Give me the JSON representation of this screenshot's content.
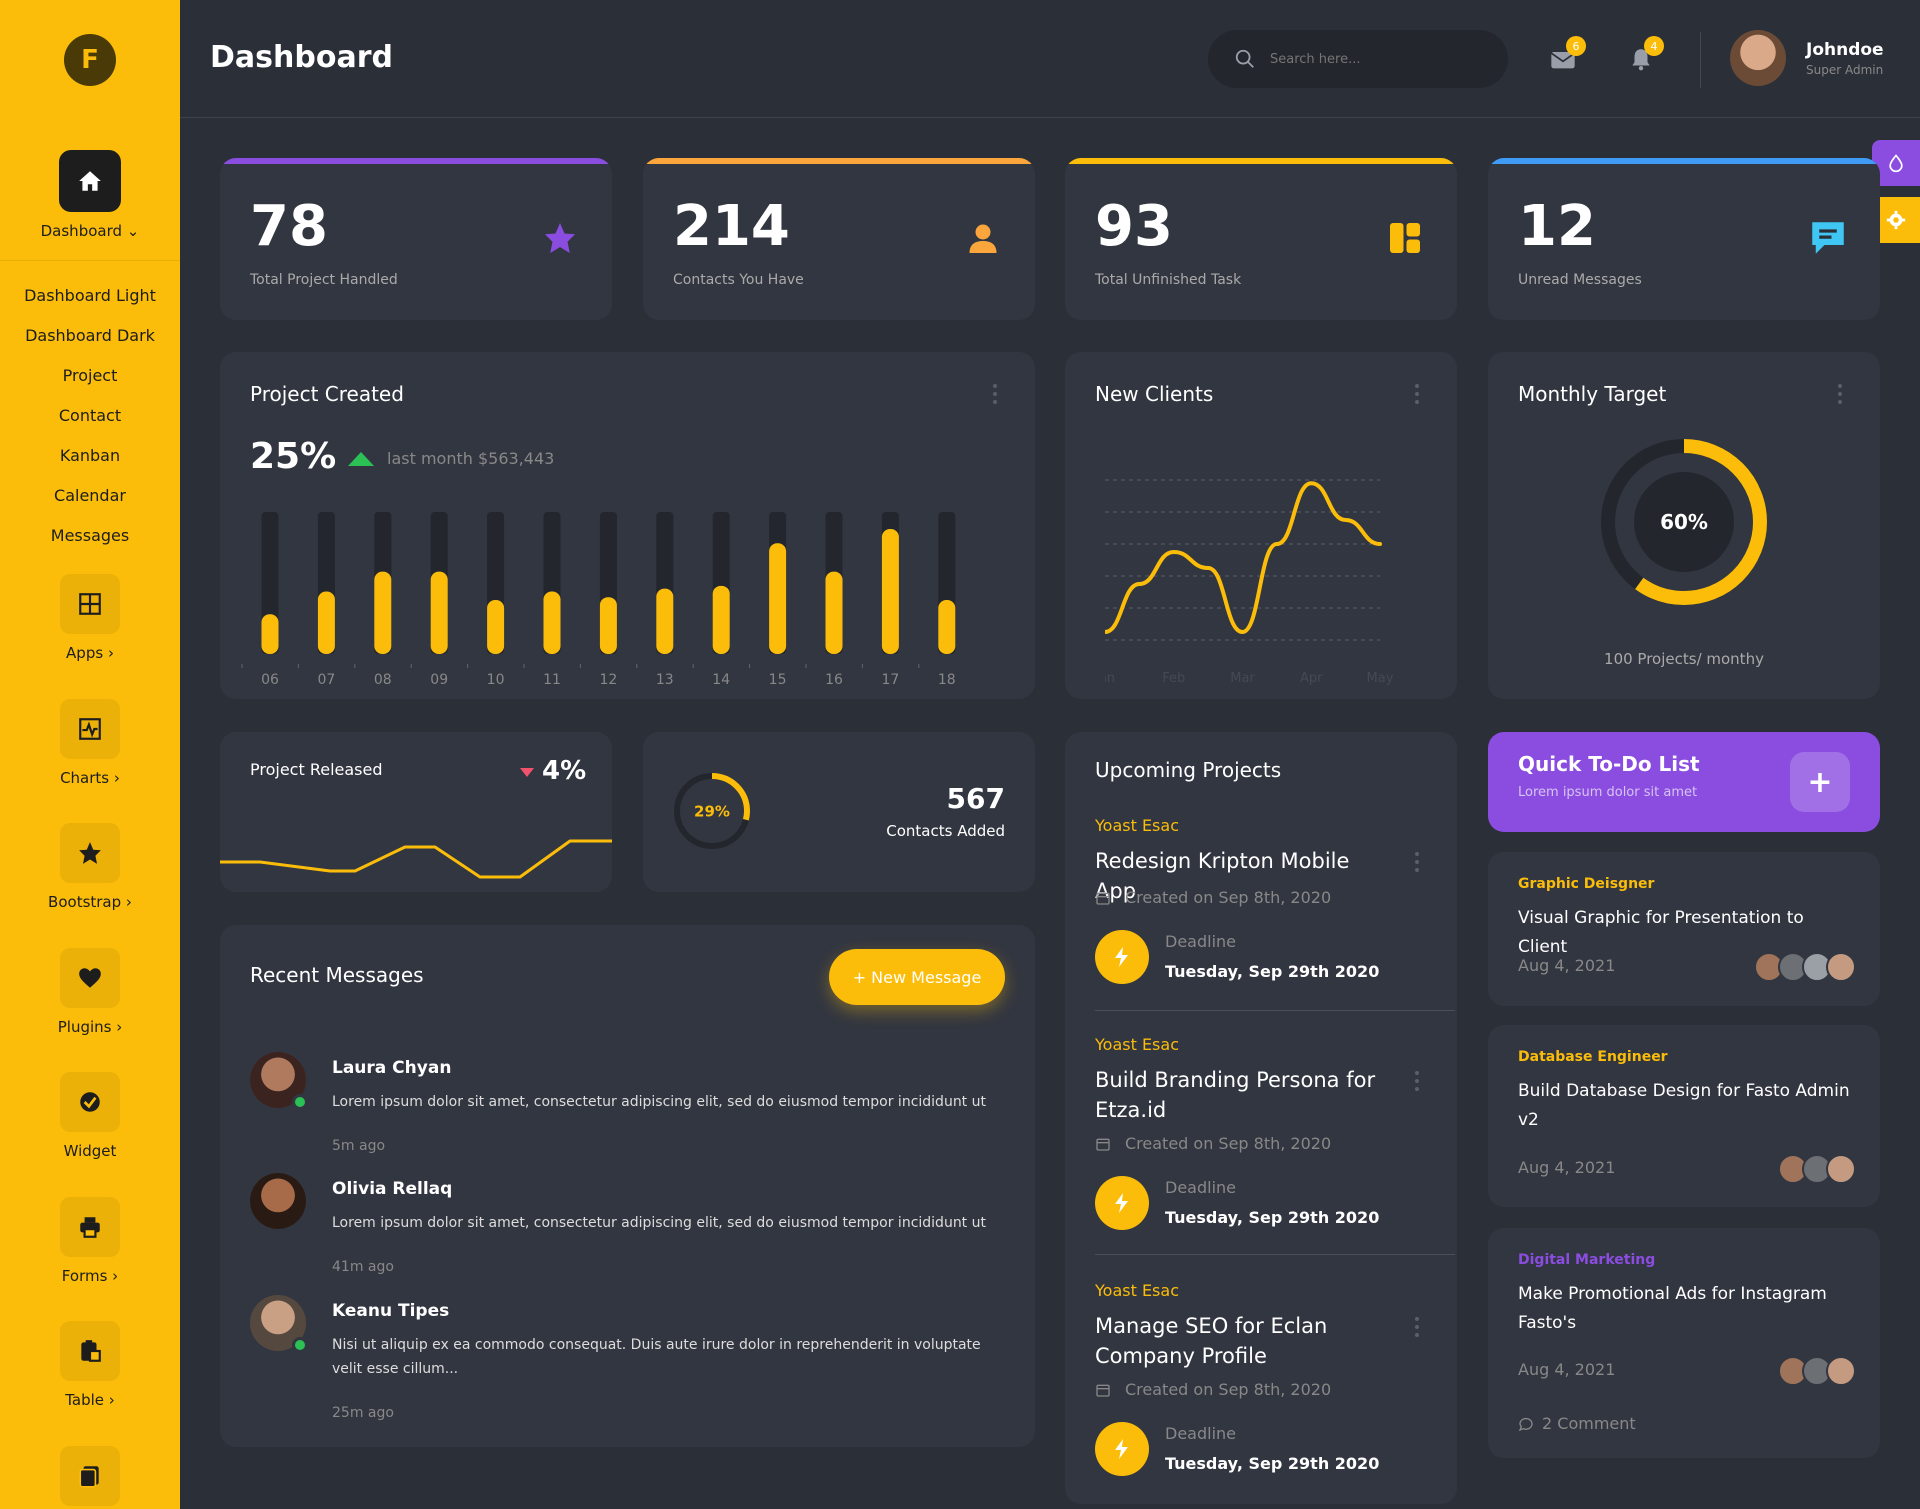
{
  "app": {
    "logo_letter": "F",
    "page_title": "Dashboard"
  },
  "sidebar": {
    "dashboard_label": "Dashboard",
    "submenu": [
      "Dashboard Light",
      "Dashboard Dark",
      "Project",
      "Contact",
      "Kanban",
      "Calendar",
      "Messages"
    ],
    "items": [
      {
        "label": "Apps",
        "icon": "grid-icon"
      },
      {
        "label": "Charts",
        "icon": "pulse-icon"
      },
      {
        "label": "Bootstrap",
        "icon": "star-icon"
      },
      {
        "label": "Plugins",
        "icon": "heart-icon"
      },
      {
        "label": "Widget",
        "icon": "check-badge-icon"
      },
      {
        "label": "Forms",
        "icon": "printer-icon"
      },
      {
        "label": "Table",
        "icon": "clipboard-icon"
      },
      {
        "label": "",
        "icon": "pages-icon"
      }
    ]
  },
  "header": {
    "search_placeholder": "Search here...",
    "mail_badge": "6",
    "bell_badge": "4",
    "user_name": "Johndoe",
    "user_role": "Super Admin"
  },
  "stats": [
    {
      "value": "78",
      "label": "Total Project Handled",
      "color": "#8a4de0",
      "icon": "star-icon"
    },
    {
      "value": "214",
      "label": "Contacts You Have",
      "color": "#fba63c",
      "icon": "user-icon"
    },
    {
      "value": "93",
      "label": "Total Unfinished Task",
      "color": "#fbbd0a",
      "icon": "widgets-icon"
    },
    {
      "value": "12",
      "label": "Unread Messages",
      "color": "#3f9bf3",
      "icon": "chat-icon"
    }
  ],
  "project_created": {
    "title": "Project Created",
    "percent": "25%",
    "subtext": "last month $563,443"
  },
  "new_clients": {
    "title": "New Clients"
  },
  "monthly_target": {
    "title": "Monthly Target",
    "center": "60%",
    "footer": "100 Projects/ monthy"
  },
  "project_released": {
    "title": "Project Released",
    "value": "4%"
  },
  "contacts_added": {
    "percent": "29%",
    "value": "567",
    "label": "Contacts Added"
  },
  "recent_messages": {
    "title": "Recent Messages",
    "button": "+ New Message",
    "items": [
      {
        "name": "Laura Chyan",
        "text": "Lorem ipsum dolor sit amet, consectetur adipiscing elit, sed do eiusmod tempor incididunt ut",
        "time": "5m ago"
      },
      {
        "name": "Olivia Rellaq",
        "text": "Lorem ipsum dolor sit amet, consectetur adipiscing elit, sed do eiusmod tempor incididunt ut",
        "time": "41m ago"
      },
      {
        "name": "Keanu Tipes",
        "text": "Nisi ut aliquip ex ea commodo consequat. Duis aute irure dolor in reprehenderit in voluptate velit esse cillum...",
        "time": "25m ago"
      }
    ]
  },
  "upcoming_projects": {
    "title": "Upcoming Projects",
    "items": [
      {
        "category": "Yoast Esac",
        "title": "Redesign Kripton Mobile App",
        "created": "Created on Sep 8th, 2020",
        "deadline_label": "Deadline",
        "deadline": "Tuesday, Sep 29th 2020"
      },
      {
        "category": "Yoast Esac",
        "title": "Build Branding Persona for Etza.id",
        "created": "Created on Sep 8th, 2020",
        "deadline_label": "Deadline",
        "deadline": "Tuesday, Sep 29th 2020"
      },
      {
        "category": "Yoast Esac",
        "title": "Manage SEO for Eclan Company Profile",
        "created": "Created on Sep 8th, 2020",
        "deadline_label": "Deadline",
        "deadline": "Tuesday, Sep 29th 2020"
      }
    ]
  },
  "quick_todo": {
    "title": "Quick To-Do List",
    "subtitle": "Lorem ipsum dolor sit amet",
    "items": [
      {
        "category": "Graphic Deisgner",
        "category_color": "#fbbd0a",
        "title": "Visual Graphic for Presentation to Client",
        "date": "Aug 4, 2021"
      },
      {
        "category": "Database Engineer",
        "category_color": "#fbbd0a",
        "title": "Build Database Design for Fasto Admin v2",
        "date": "Aug 4, 2021"
      },
      {
        "category": "Digital Marketing",
        "category_color": "#8a4de0",
        "title": "Make Promotional Ads for Instagram Fasto's",
        "date": "Aug 4, 2021",
        "comments": "2 Comment"
      }
    ]
  },
  "chart_data": [
    {
      "type": "bar",
      "title": "Project Created",
      "categories": [
        "06",
        "07",
        "08",
        "09",
        "10",
        "11",
        "12",
        "13",
        "14",
        "15",
        "16",
        "17",
        "18"
      ],
      "values": [
        28,
        44,
        58,
        58,
        38,
        44,
        40,
        46,
        48,
        78,
        58,
        88,
        38
      ],
      "ylim": [
        0,
        100
      ],
      "color": "#fbbd0a"
    },
    {
      "type": "line",
      "title": "New Clients",
      "categories": [
        "Jan",
        "Feb",
        "Mar",
        "Apr",
        "May"
      ],
      "x": [
        0,
        0.5,
        1,
        1.5,
        2,
        2.5,
        3,
        3.5,
        4
      ],
      "values": [
        5,
        35,
        55,
        45,
        5,
        60,
        98,
        75,
        60
      ],
      "ylim": [
        0,
        100
      ],
      "color": "#fbbd0a"
    },
    {
      "type": "pie",
      "title": "Monthly Target",
      "values": [
        60,
        40
      ],
      "labels": [
        "60%",
        ""
      ],
      "colors": [
        "#fbbd0a",
        "#23262d"
      ]
    },
    {
      "type": "line",
      "title": "Project Released",
      "values": [
        30,
        30,
        15,
        15,
        55,
        55,
        5,
        5,
        65,
        65
      ],
      "ylim": [
        0,
        100
      ],
      "color": "#fbbd0a"
    },
    {
      "type": "pie",
      "title": "Contacts Added",
      "values": [
        29,
        71
      ],
      "labels": [
        "29%",
        ""
      ],
      "colors": [
        "#fbbd0a",
        "#23262d"
      ]
    }
  ]
}
